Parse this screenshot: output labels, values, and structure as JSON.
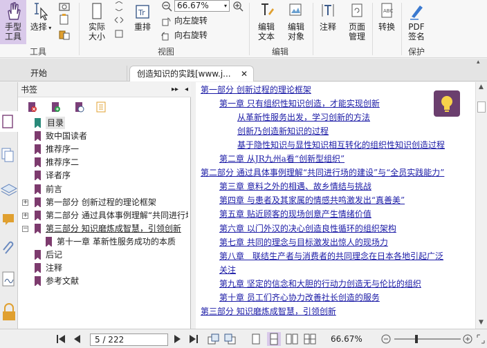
{
  "ribbon": {
    "hand_tool": "手型\n工具",
    "select": "选择",
    "actual_size": "实际\n大小",
    "reflow": "重排",
    "zoom_value": "66.67%",
    "rotate_left": "向左旋转",
    "rotate_right": "向右旋转",
    "edit_text": "编辑\n文本",
    "edit_object": "编辑\n对象",
    "annotate": "注释",
    "page_manage": "页面\n管理",
    "convert": "转换",
    "pdf_sign": "PDF\n签名",
    "group_tools": "工具",
    "group_view": "视图",
    "group_edit": "编辑",
    "group_protect": "保护"
  },
  "tabs": {
    "start": "开始",
    "document": "创造知识的实践[www.j..."
  },
  "bookmarks": {
    "title": "书签",
    "items": [
      {
        "label": "目录",
        "level": 0,
        "selected": true
      },
      {
        "label": "致中国读者",
        "level": 0
      },
      {
        "label": "推荐序一",
        "level": 0
      },
      {
        "label": "推荐序二",
        "level": 0
      },
      {
        "label": "译者序",
        "level": 0
      },
      {
        "label": "前言",
        "level": 0
      },
      {
        "label": "第一部分 创新过程的理论框架",
        "level": 0,
        "expander": "+"
      },
      {
        "label": "第二部分 通过具体事例理解“共同进行均",
        "level": 0,
        "expander": "+"
      },
      {
        "label": "第三部分 知识磨炼成智慧，引领创新",
        "level": 0,
        "expander": "−",
        "underline": true
      },
      {
        "label": "第十一章 革新性服务成功的本质",
        "level": 1
      },
      {
        "label": "后记",
        "level": 0
      },
      {
        "label": "注释",
        "level": 0
      },
      {
        "label": "参考文献",
        "level": 0
      }
    ]
  },
  "toc": [
    {
      "text": "第一部分 创新过程的理论框架",
      "indent": 0
    },
    {
      "text": "第一章 只有组织性知识创造，才能实现创新",
      "indent": 1
    },
    {
      "text": "从革新性服务出发，学习创新的方法",
      "indent": 2
    },
    {
      "text": "创新乃创造新知识的过程",
      "indent": 2
    },
    {
      "text": "基于隐性知识与显性知识相互转化的组织性知识创造过程",
      "indent": 2
    },
    {
      "text": "第二章 从JR九州a看“创新型组织”",
      "indent": 1
    },
    {
      "text": "第二部分 通过具体事例理解“共同进行场的建设”与“全员实践能力”",
      "indent": 0
    },
    {
      "text": "第三章 意料之外的相遇、故乡情结与挑战",
      "indent": 1
    },
    {
      "text": "第四章 与患者及其家属的情感共鸣激发出“真善美”",
      "indent": 1
    },
    {
      "text": "第五章 贴近顾客的现场创意产生情绪价值",
      "indent": 1
    },
    {
      "text": "第六章 以门外汉的决心创造良性循环的组织架构",
      "indent": 1
    },
    {
      "text": "第七章 共同的理念与目标激发出惊人的现场力",
      "indent": 1
    },
    {
      "text": "第八章　联结生产者与消费者的共同理念在日本各地引起广泛",
      "indent": 1
    },
    {
      "text": "关注",
      "indent": 1
    },
    {
      "text": "第九章 坚定的信念和大胆的行动力创造无与伦比的组织",
      "indent": 1
    },
    {
      "text": "第十章 员工们齐心协力改善社长创造的服务",
      "indent": 1
    },
    {
      "text": "第三部分 知识磨炼成智慧，引领创新",
      "indent": 0
    }
  ],
  "status": {
    "page_display": "5 / 222",
    "zoom": "66.67%"
  },
  "colors": {
    "link": "#1a1aa6",
    "bookmark_flag": "#7d3b6e",
    "bookmark_flag_selected": "#2a8a7a",
    "accent": "#7b3f78",
    "tip_bg": "#6b3f6e"
  }
}
